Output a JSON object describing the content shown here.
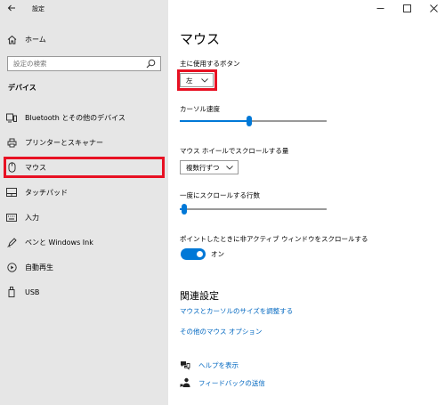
{
  "titlebar": {
    "title": "設定"
  },
  "sidebar": {
    "home_label": "ホーム",
    "search_placeholder": "設定の検索",
    "section_label": "デバイス",
    "items": [
      {
        "label": "Bluetooth とその他のデバイス",
        "icon": "bluetooth-devices-icon"
      },
      {
        "label": "プリンターとスキャナー",
        "icon": "printer-icon"
      },
      {
        "label": "マウス",
        "icon": "mouse-icon"
      },
      {
        "label": "タッチパッド",
        "icon": "touchpad-icon"
      },
      {
        "label": "入力",
        "icon": "keyboard-icon"
      },
      {
        "label": "ペンと Windows Ink",
        "icon": "pen-icon"
      },
      {
        "label": "自動再生",
        "icon": "autoplay-icon"
      },
      {
        "label": "USB",
        "icon": "usb-icon"
      }
    ],
    "selected_index": 2
  },
  "main": {
    "title": "マウス",
    "primary_button": {
      "label": "主に使用するボタン",
      "value": "左"
    },
    "cursor_speed": {
      "label": "カーソル速度",
      "value_fraction": 0.47
    },
    "wheel_scroll": {
      "label": "マウス ホイールでスクロールする量",
      "value": "複数行ずつ"
    },
    "lines_to_scroll": {
      "label": "一度にスクロールする行数",
      "value_fraction": 0.03
    },
    "inactive_scroll": {
      "label": "ポイントしたときに非アクティブ ウィンドウをスクロールする",
      "state": "オン"
    },
    "related": {
      "title": "関連設定",
      "links": [
        "マウスとカーソルのサイズを調整する",
        "その他のマウス オプション"
      ]
    },
    "help": {
      "help_label": "ヘルプを表示",
      "feedback_label": "フィードバックの送信"
    }
  },
  "colors": {
    "accent": "#0078d7",
    "link": "#0067c0",
    "highlight": "#e81123",
    "sidebar_bg": "#e6e6e6"
  }
}
